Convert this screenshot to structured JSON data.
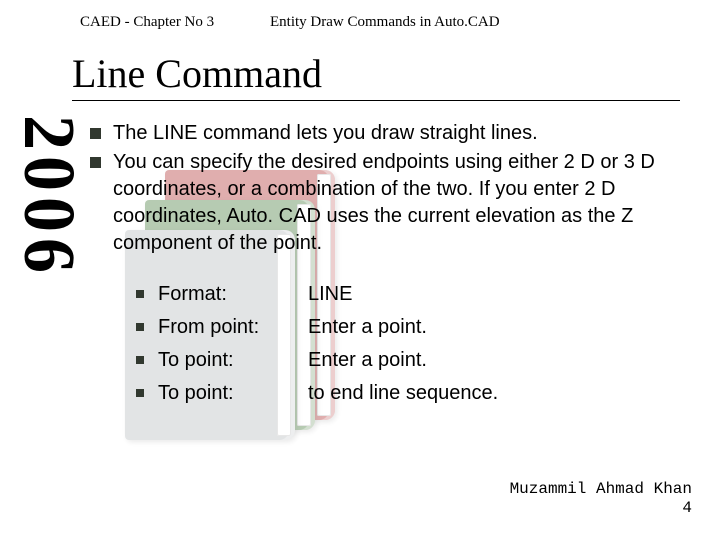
{
  "sideYear": "2006",
  "header": {
    "left": "CAED - Chapter No 3",
    "right": "Entity Draw Commands in Auto.CAD"
  },
  "title": "Line Command",
  "bullets": [
    "The LINE command lets you draw straight lines.",
    "You can specify the desired endpoints using either 2 D or 3 D coordinates, or a combination of the two. If you enter 2 D coordinates, Auto. CAD uses the current elevation as the Z component of the point."
  ],
  "subitems": [
    {
      "label": "Format:",
      "value": "LINE"
    },
    {
      "label": "From point:",
      "value": "Enter a point."
    },
    {
      "label": "To point:",
      "value": "Enter a point."
    },
    {
      "label": "To point:",
      "value": "to end line sequence."
    }
  ],
  "footer": {
    "author": "Muzammil Ahmad Khan",
    "page": "4"
  }
}
